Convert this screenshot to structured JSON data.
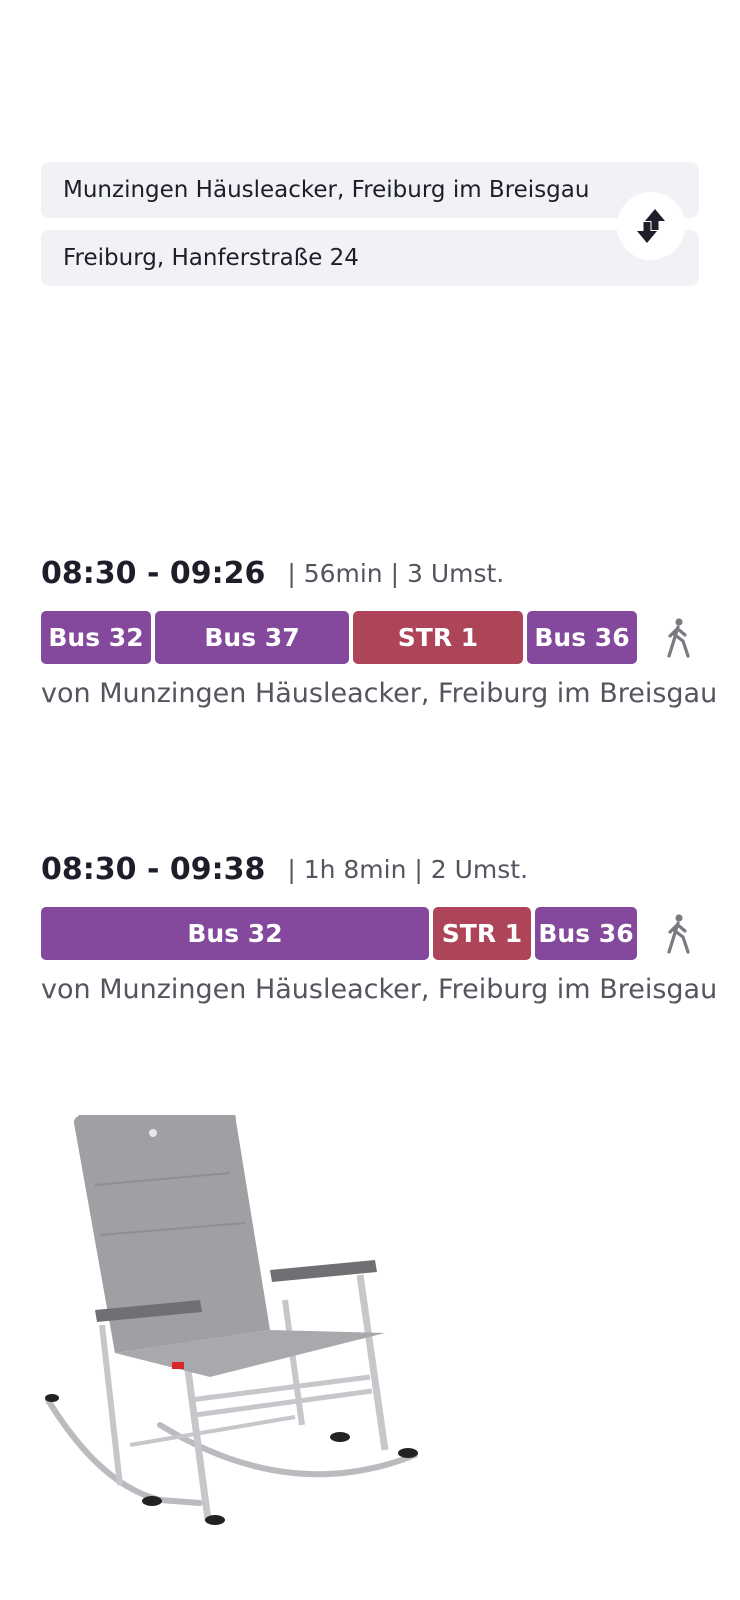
{
  "search": {
    "from": "Munzingen Häusleacker, Freiburg im Breisgau",
    "to": "Freiburg, Hanferstraße 24",
    "swap_icon": "swap-vertical-icon"
  },
  "journeys": [
    {
      "time": "08:30 - 09:26",
      "meta": "| 56min | 3 Umst.",
      "legs": [
        {
          "label": "Bus 32",
          "mode": "bus"
        },
        {
          "label": "Bus 37",
          "mode": "bus"
        },
        {
          "label": "STR 1",
          "mode": "tram"
        },
        {
          "label": "Bus 36",
          "mode": "bus"
        }
      ],
      "walk_icon": "walking-person-icon",
      "from": "von Munzingen Häusleacker, Freiburg im Breisgau"
    },
    {
      "time": "08:30 - 09:38",
      "meta": "| 1h 8min | 2 Umst.",
      "legs": [
        {
          "label": "Bus 32",
          "mode": "bus"
        },
        {
          "label": "STR 1",
          "mode": "tram"
        },
        {
          "label": "Bus 36",
          "mode": "bus"
        }
      ],
      "walk_icon": "walking-person-icon",
      "from": "von Munzingen Häusleacker, Freiburg im Breisgau"
    }
  ],
  "ad": {
    "image": "rocking-chair-image"
  },
  "colors": {
    "bus": "#84499c",
    "tram": "#ad4457",
    "field_bg": "#f0f2f5",
    "secondary_text": "#555560"
  }
}
